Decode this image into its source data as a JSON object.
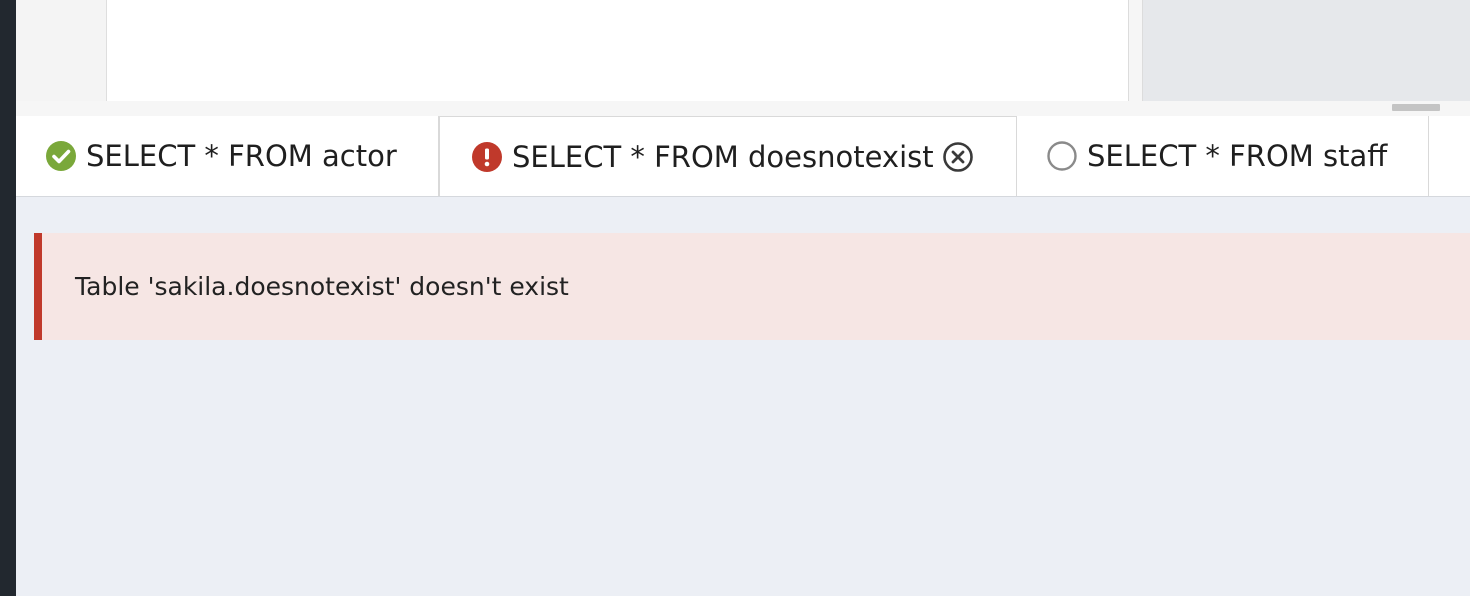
{
  "tabs": [
    {
      "label": "SELECT * FROM actor",
      "status": "success",
      "icon": "check-circle-icon"
    },
    {
      "label": "SELECT * FROM doesnotexist",
      "status": "error",
      "icon": "error-circle-icon",
      "active": true
    },
    {
      "label": "SELECT * FROM staff",
      "status": "pending",
      "icon": "empty-circle-icon"
    }
  ],
  "error": {
    "message": "Table 'sakila.doesnotexist' doesn't exist"
  },
  "colors": {
    "success": "#7aa83a",
    "error": "#c0392b",
    "pending": "#8a8a8a",
    "error_bg": "#f6e6e4",
    "results_bg": "#eceff5"
  }
}
